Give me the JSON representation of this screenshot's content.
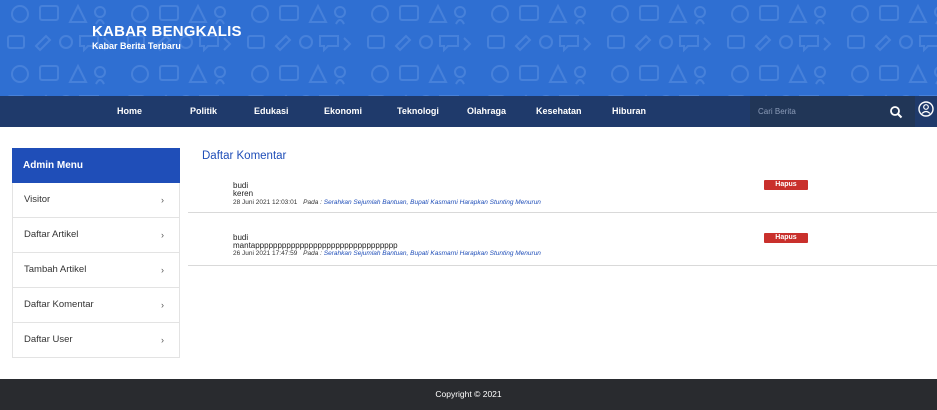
{
  "brand": {
    "title": "KABAR BENGKALIS",
    "subtitle": "Kabar Berita Terbaru"
  },
  "nav": [
    {
      "label": "Home"
    },
    {
      "label": "Politik"
    },
    {
      "label": "Edukasi"
    },
    {
      "label": "Ekonomi"
    },
    {
      "label": "Teknologi"
    },
    {
      "label": "Olahraga"
    },
    {
      "label": "Kesehatan"
    },
    {
      "label": "Hiburan"
    }
  ],
  "search": {
    "placeholder": "Cari Berita"
  },
  "sidebar": {
    "heading": "Admin Menu",
    "items": [
      {
        "label": "Visitor",
        "chevron": "›"
      },
      {
        "label": "Daftar Artikel",
        "chevron": "›"
      },
      {
        "label": "Tambah Artikel",
        "chevron": "›"
      },
      {
        "label": "Daftar Komentar",
        "chevron": "›"
      },
      {
        "label": "Daftar User",
        "chevron": "›"
      }
    ]
  },
  "main": {
    "title": "Daftar Komentar",
    "comments": [
      {
        "name": "budi",
        "text": "keren",
        "date": "28 Juni 2021 12:03:01",
        "pada": "Pada :",
        "article": "Serahkan Sejumlah Bantuan, Bupati Kasmarni Harapkan Stunting Menurun",
        "delete_label": "Hapus"
      },
      {
        "name": "budi",
        "text": "mantapppppppppppppppppppppppppppppppp",
        "date": "26 Juni 2021 17:47:59",
        "pada": "Pada :",
        "article": "Serahkan Sejumlah Bantuan, Bupati Kasmarni Harapkan Stunting Menurun",
        "delete_label": "Hapus"
      }
    ]
  },
  "footer": {
    "copyright": "Copyright © 2021"
  },
  "colors": {
    "header_bg": "#2f6fd2",
    "navbar_bg": "#1f3a6b",
    "accent": "#1f4eb8",
    "danger": "#c9302c",
    "footer_bg": "#292b2f"
  },
  "icons": {
    "search": "search-icon",
    "user": "user-icon"
  }
}
